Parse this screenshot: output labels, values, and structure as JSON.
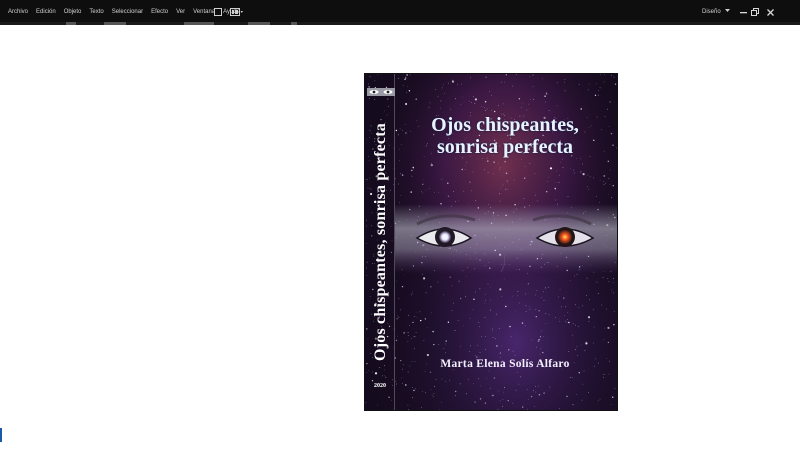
{
  "menu": {
    "items": [
      "Archivo",
      "Edición",
      "Objeto",
      "Texto",
      "Seleccionar",
      "Efecto",
      "Ver",
      "Ventana",
      "Ayuda"
    ]
  },
  "workspace": {
    "label": "Diseño",
    "icon": "chevron-down-icon"
  },
  "window_controls": [
    "minimize-icon",
    "restore-icon",
    "close-icon"
  ],
  "book": {
    "title_line1": "Ojos chispeantes,",
    "title_line2": "sonrisa perfecta",
    "spine_title": "Ojos chispeantes, sonrisa perfecta",
    "author": "Marta Elena Solís Alfaro",
    "year": "2020"
  },
  "colors": {
    "appbar_bg": "#0e0e0e",
    "cover_sky": "#2a1638",
    "cover_nebula": "#7a2a4a",
    "eye_glow_left": "#ffffff",
    "eye_glow_right": "#ff5a1a"
  }
}
